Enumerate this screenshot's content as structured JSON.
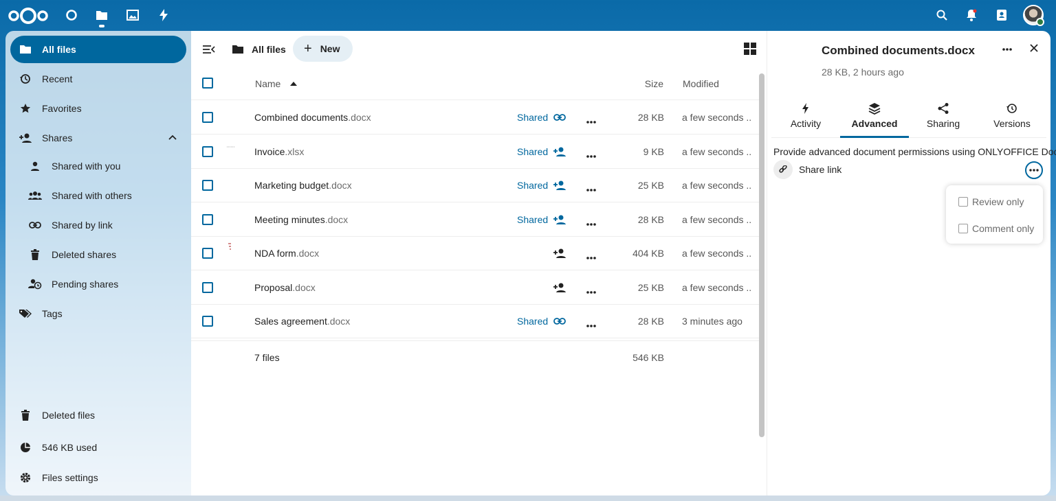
{
  "header": {
    "apps": [
      {
        "name": "dashboard",
        "icon": "circle-icon"
      },
      {
        "name": "files",
        "icon": "folder-icon"
      },
      {
        "name": "photos",
        "icon": "image-icon"
      },
      {
        "name": "activity",
        "icon": "lightning-icon"
      }
    ],
    "right_icons": [
      "search-icon",
      "bell-icon",
      "contacts-icon"
    ]
  },
  "nav": {
    "items": [
      {
        "label": "All files",
        "icon": "folder-icon"
      },
      {
        "label": "Recent",
        "icon": "history-icon"
      },
      {
        "label": "Favorites",
        "icon": "star-icon"
      },
      {
        "label": "Shares",
        "icon": "share-user-icon"
      },
      {
        "label": "Shared with you",
        "icon": "person-icon"
      },
      {
        "label": "Shared with others",
        "icon": "group-icon"
      },
      {
        "label": "Shared by link",
        "icon": "link-icon"
      },
      {
        "label": "Deleted shares",
        "icon": "trash-icon"
      },
      {
        "label": "Pending shares",
        "icon": "pending-icon"
      },
      {
        "label": "Tags",
        "icon": "tag-icon"
      }
    ],
    "footer": {
      "deleted_files": "Deleted files",
      "usage": "546 KB used",
      "settings": "Files settings"
    }
  },
  "toolbar": {
    "breadcrumb": "All files",
    "new_label": "New"
  },
  "list": {
    "columns": {
      "name": "Name",
      "size": "Size",
      "modified": "Modified"
    },
    "rows": [
      {
        "base": "Combined documents",
        "ext": ".docx",
        "shared": "Shared",
        "share_icon": "link-icon",
        "size": "28 KB",
        "modified": "a few seconds ..."
      },
      {
        "base": "Invoice",
        "ext": ".xlsx",
        "shared": "Shared",
        "share_icon": "person-add-icon",
        "size": "9 KB",
        "modified": "a few seconds ..."
      },
      {
        "base": "Marketing budget",
        "ext": ".docx",
        "shared": "Shared",
        "share_icon": "person-add-icon",
        "size": "25 KB",
        "modified": "a few seconds ..."
      },
      {
        "base": "Meeting minutes",
        "ext": ".docx",
        "shared": "Shared",
        "share_icon": "person-add-icon",
        "size": "28 KB",
        "modified": "a few seconds ..."
      },
      {
        "base": "NDA form",
        "ext": ".docx",
        "shared": "",
        "share_icon": "person-add-icon",
        "size": "404 KB",
        "modified": "a few seconds ..."
      },
      {
        "base": "Proposal",
        "ext": ".docx",
        "shared": "",
        "share_icon": "person-add-icon",
        "size": "25 KB",
        "modified": "a few seconds ..."
      },
      {
        "base": "Sales agreement",
        "ext": ".docx",
        "shared": "Shared",
        "share_icon": "link-icon",
        "size": "28 KB",
        "modified": "3 minutes ago"
      }
    ],
    "summary": {
      "count": "7 files",
      "size": "546 KB"
    }
  },
  "sidebar": {
    "title": "Combined documents.docx",
    "subtitle": "28 KB, 2 hours ago",
    "tabs": [
      {
        "label": "Activity",
        "icon": "lightning-icon"
      },
      {
        "label": "Advanced",
        "icon": "layers-icon"
      },
      {
        "label": "Sharing",
        "icon": "share-icon"
      },
      {
        "label": "Versions",
        "icon": "history-icon"
      }
    ],
    "advanced_desc": "Provide advanced document permissions using ONLYOFFICE Docs",
    "share_link": "Share link",
    "options": [
      "Review only",
      "Comment only"
    ]
  },
  "colors": {
    "primary": "#00679e",
    "header": "#0a6aa8"
  }
}
